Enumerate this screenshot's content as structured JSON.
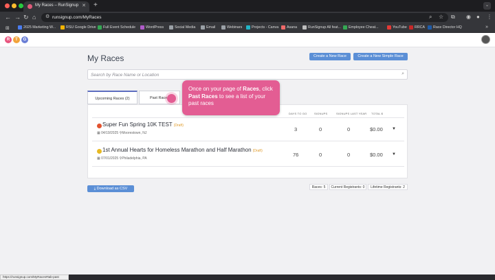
{
  "browser": {
    "tab_title": "My Races – RunSignup",
    "tab_close": "✕",
    "new_tab": "+",
    "url": "runsignup.com/MyRaces",
    "status_url": "https://runsignup.com/MyRaces#tab-past"
  },
  "bookmarks": [
    {
      "label": "2025 Marketing W...",
      "color": "#4a7cf0"
    },
    {
      "label": "RSU Google Drive",
      "color": "#f4b400"
    },
    {
      "label": "Full Event Schedule",
      "color": "#34a853"
    },
    {
      "label": "WordPress",
      "color": "#b05bc9"
    },
    {
      "label": "Social Media",
      "color": "#9aa0a6"
    },
    {
      "label": "Email",
      "color": "#9aa0a6"
    },
    {
      "label": "Webinars",
      "color": "#9aa0a6"
    },
    {
      "label": "Projects - Canva",
      "color": "#22b5c7"
    },
    {
      "label": "Asana",
      "color": "#f06a6a"
    },
    {
      "label": "RunSignup All feat...",
      "color": "#bdbdbd"
    },
    {
      "label": "Employee Cheat...",
      "color": "#34a853"
    },
    {
      "label": "YouTube",
      "color": "#e53935"
    },
    {
      "label": "RRCA",
      "color": "#c62828"
    },
    {
      "label": "Race Director HQ",
      "color": "#1e5ba8"
    }
  ],
  "logo_letters": [
    "R",
    "T",
    "G"
  ],
  "page": {
    "title": "My Races",
    "create_race_label": "Create a New Race",
    "create_simple_race_label": "Create a New Simple Race",
    "search_placeholder": "Search by Race Name or Location",
    "tabs": [
      {
        "label": "Upcoming Races (2)",
        "active": true
      },
      {
        "label": "Past Races",
        "active": false
      }
    ],
    "columns": [
      "DAYS TO GO",
      "SIGNUPS",
      "SIGNUPS LAST YEAR",
      "TOTAL $"
    ],
    "races": [
      {
        "name": "Super Fun Spring 10K TEST",
        "status": "(Draft)",
        "date": "04/19/2025",
        "location": "Moorestown, NJ",
        "days_to_go": "3",
        "signups": "0",
        "signups_last_year": "0",
        "total": "$0.00",
        "icon_color": "#e2532f"
      },
      {
        "name": "1st Annual Hearts for Homeless Marathon and Half Marathon",
        "status": "(Draft)",
        "date": "07/01/2025",
        "location": "Philadelphia, PA",
        "days_to_go": "76",
        "signups": "0",
        "signups_last_year": "0",
        "total": "$0.00",
        "icon_color": "#e8b923"
      }
    ],
    "download_csv_label": "Download as CSV",
    "stats": {
      "races": "Races: 5",
      "current_registrants": "Current Registrants: 0",
      "lifetime_registrants": "Lifetime Registrants: 2"
    }
  },
  "callout": {
    "text_1": "Once on your page of ",
    "bold_1": "Races",
    "text_2": ", click ",
    "bold_2": "Past Races",
    "text_3": " to see a list of your past races"
  },
  "colors": {
    "accent_blue": "#5b8fd6",
    "callout_pink": "#e35d93",
    "draft_orange": "#e09b2a"
  }
}
